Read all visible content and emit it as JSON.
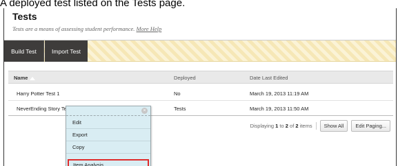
{
  "caption": "A deployed test listed on the Tests page.",
  "page": {
    "title": "Tests",
    "subtitle": "Tests are a means of assessing student performance.",
    "help_link": "More Help"
  },
  "toolbar": {
    "build_label": "Build Test",
    "import_label": "Import Test"
  },
  "table": {
    "headers": {
      "name": "Name",
      "deployed": "Deployed",
      "date": "Date Last Edited"
    },
    "rows": [
      {
        "name": "Harry Potter Test 1",
        "deployed": "No",
        "date": "March 19, 2013 11:19 AM"
      },
      {
        "name": "NeverEnding Story Test",
        "deployed": "Tests",
        "date": "March 19, 2013 11:50 AM"
      }
    ]
  },
  "paging": {
    "prefix": "Displaying",
    "from": "1",
    "mid": "to",
    "to": "2",
    "of": "of",
    "total": "2",
    "suffix": "items",
    "show_all": "Show All",
    "edit_paging": "Edit Paging..."
  },
  "context_menu": {
    "items": [
      "Edit",
      "Export",
      "Copy",
      "Item Analysis"
    ],
    "highlight_color": "#e02a2a"
  }
}
